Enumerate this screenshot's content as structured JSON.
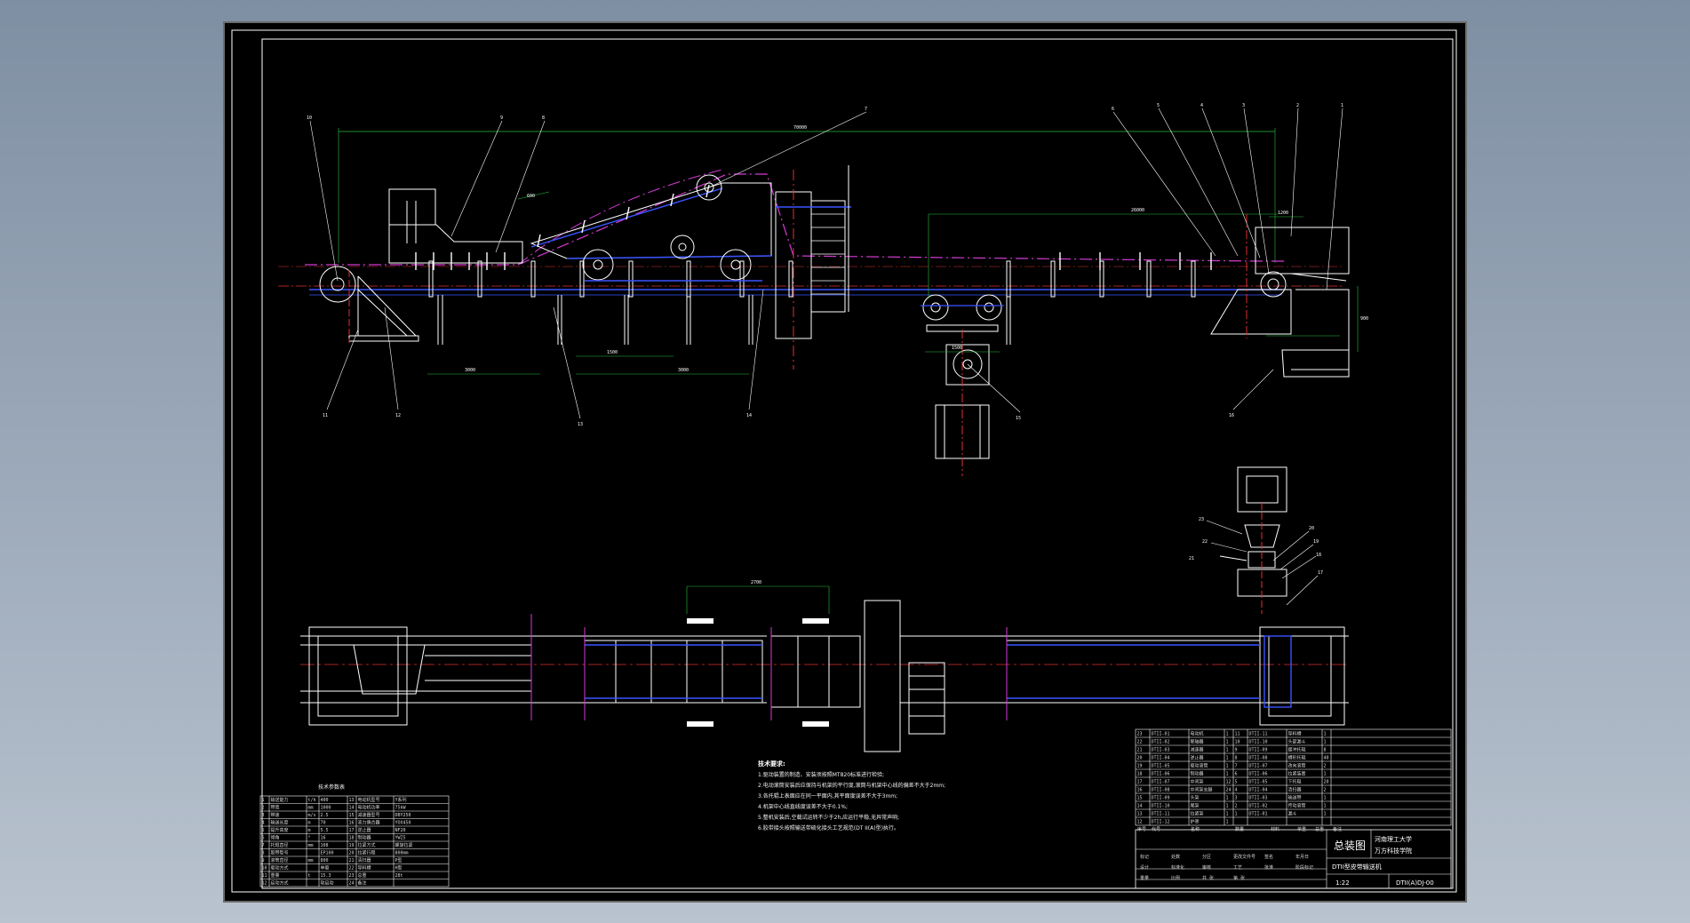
{
  "drawing": {
    "callouts_top": [
      "10",
      "9",
      "8",
      "7",
      "6",
      "5",
      "4",
      "3",
      "2",
      "1"
    ],
    "callouts_bottom": [
      "11",
      "12",
      "13",
      "14",
      "15",
      "16"
    ],
    "callouts_drive": [
      "23",
      "22",
      "21",
      "20",
      "19",
      "18",
      "17"
    ],
    "dimensions": {
      "overall": "70000",
      "spacing_a": "600",
      "right_span": "26000",
      "right_small": "1200",
      "height": "900",
      "lower_left": "3000",
      "lower_mid_a": "1500",
      "lower_mid_b": "3000",
      "under": "1500",
      "plan_top": "2700"
    }
  },
  "tech_requirements": {
    "heading": "技术要求:",
    "lines": [
      "1.驱动装置的制造、安装须按照MT820标准进行检验;",
      "2.电动滚筒安装后应保持与机架的平行度,滚筒与机架中心线的偏差不大于2mm;",
      "3.各托辊上表面应在同一平面内,其平面度误差不大于3mm;",
      "4.机架中心线直线度误差不大于0.1%;",
      "5.整机安装后,空载试运转不少于2h,应运行平稳,无异常声响;",
      "6.胶带接头按照输送带硫化接头工艺规范(DT II(A)型)执行。"
    ]
  },
  "spec_table": {
    "title": "技术参数表",
    "rows": [
      [
        "1",
        "输送能力",
        "t/h",
        "400",
        "13",
        "电动机型号",
        "Y系列"
      ],
      [
        "2",
        "带宽",
        "mm",
        "1000",
        "14",
        "电动机功率",
        "75kW"
      ],
      [
        "3",
        "带速",
        "m/s",
        "2.5",
        "15",
        "减速器型号",
        "DBY250"
      ],
      [
        "4",
        "输送长度",
        "m",
        "70",
        "16",
        "液力偶合器",
        "YOX450"
      ],
      [
        "5",
        "提升高度",
        "m",
        "5.5",
        "17",
        "逆止器",
        "NF20"
      ],
      [
        "6",
        "倾角",
        "°",
        "16",
        "18",
        "制动器",
        "YWZ5"
      ],
      [
        "7",
        "托辊直径",
        "mm",
        "108",
        "19",
        "拉紧方式",
        "螺旋拉紧"
      ],
      [
        "8",
        "胶带型号",
        "",
        "EP100",
        "20",
        "拉紧行程",
        "800mm"
      ],
      [
        "9",
        "滚筒直径",
        "mm",
        "800",
        "21",
        "清扫器",
        "P型"
      ],
      [
        "10",
        "驱动方式",
        "",
        "单驱",
        "22",
        "导料槽",
        "H型"
      ],
      [
        "11",
        "重量",
        "t",
        "15.3",
        "23",
        "总重",
        "28t"
      ],
      [
        "12",
        "启动方式",
        "",
        "软启动",
        "24",
        "备注",
        ""
      ]
    ]
  },
  "parts_list": {
    "rows": [
      [
        "23",
        "DTII-01",
        "电动机",
        "1",
        "11",
        "DTII-11",
        "导料槽",
        "1"
      ],
      [
        "22",
        "DTII-02",
        "联轴器",
        "1",
        "10",
        "DTII-10",
        "头部漏斗",
        "1"
      ],
      [
        "21",
        "DTII-03",
        "减速器",
        "1",
        "9",
        "DTII-09",
        "缓冲托辊",
        "8"
      ],
      [
        "20",
        "DTII-04",
        "逆止器",
        "1",
        "8",
        "DTII-08",
        "槽形托辊",
        "40"
      ],
      [
        "19",
        "DTII-05",
        "驱动滚筒",
        "1",
        "7",
        "DTII-07",
        "改向滚筒",
        "2"
      ],
      [
        "18",
        "DTII-06",
        "制动器",
        "1",
        "6",
        "DTII-06",
        "拉紧装置",
        "1"
      ],
      [
        "17",
        "DTII-07",
        "中间架",
        "12",
        "5",
        "DTII-05",
        "下托辊",
        "20"
      ],
      [
        "16",
        "DTII-08",
        "中间架支腿",
        "24",
        "4",
        "DTII-04",
        "清扫器",
        "2"
      ],
      [
        "15",
        "DTII-09",
        "头架",
        "1",
        "3",
        "DTII-03",
        "输送带",
        "1"
      ],
      [
        "14",
        "DTII-10",
        "尾架",
        "1",
        "2",
        "DTII-02",
        "传动滚筒",
        "1"
      ],
      [
        "13",
        "DTII-11",
        "拉紧架",
        "1",
        "1",
        "DTII-01",
        "漏斗",
        "1"
      ],
      [
        "12",
        "DTII-12",
        "护罩",
        "1",
        "",
        "",
        "",
        ""
      ]
    ],
    "header": [
      "序号",
      "代号",
      "名称",
      "数量",
      "材料",
      "单重",
      "总重",
      "备注"
    ]
  },
  "title_block": {
    "drawing_name": "总装图",
    "school": "河南理工大学",
    "college": "万方科技学院",
    "product": "DTII型皮带输送机",
    "drawing_no": "DTII(A)DJ-00",
    "scale": "1:22",
    "labels": [
      "标记",
      "处数",
      "分区",
      "更改文件号",
      "签名",
      "年月日",
      "设计",
      "标准化",
      "审核",
      "工艺",
      "批准",
      "阶段标记",
      "重量",
      "比例",
      "共 张",
      "第 张"
    ]
  }
}
